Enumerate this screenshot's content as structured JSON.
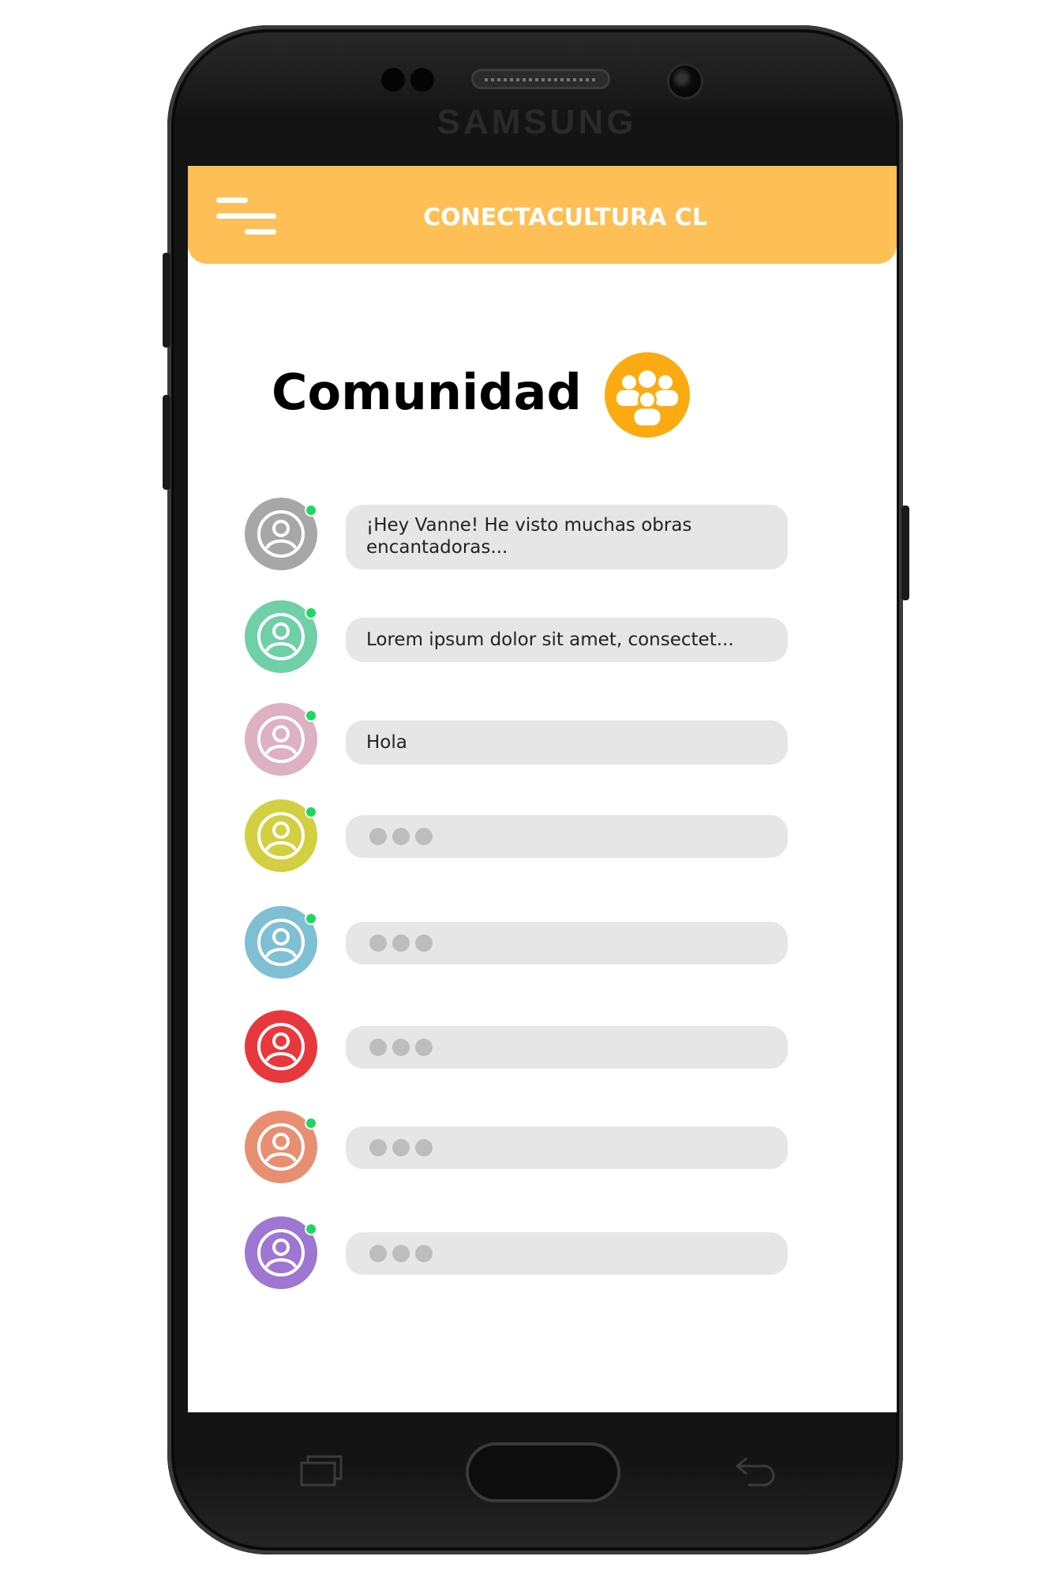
{
  "device": {
    "brand": "SAMSUNG"
  },
  "app_bar": {
    "title": "CONECTACULTURA CL",
    "color": "#fdbf56"
  },
  "page": {
    "title": "Comunidad",
    "icon_color": "#fbab11"
  },
  "chats": [
    {
      "avatar_color": "#a7a7a7",
      "online": true,
      "message": "¡Hey Vanne! He visto muchas obras encantadoras..."
    },
    {
      "avatar_color": "#6fcfa6",
      "online": true,
      "message": "Lorem ipsum dolor sit amet, consectet..."
    },
    {
      "avatar_color": "#ddb1c2",
      "online": true,
      "message": "Hola"
    },
    {
      "avatar_color": "#d2cf40",
      "online": true,
      "message": ""
    },
    {
      "avatar_color": "#7ebfd4",
      "online": true,
      "message": ""
    },
    {
      "avatar_color": "#e8383e",
      "online": false,
      "message": ""
    },
    {
      "avatar_color": "#e88f72",
      "online": true,
      "message": ""
    },
    {
      "avatar_color": "#9d77d1",
      "online": true,
      "message": ""
    }
  ]
}
